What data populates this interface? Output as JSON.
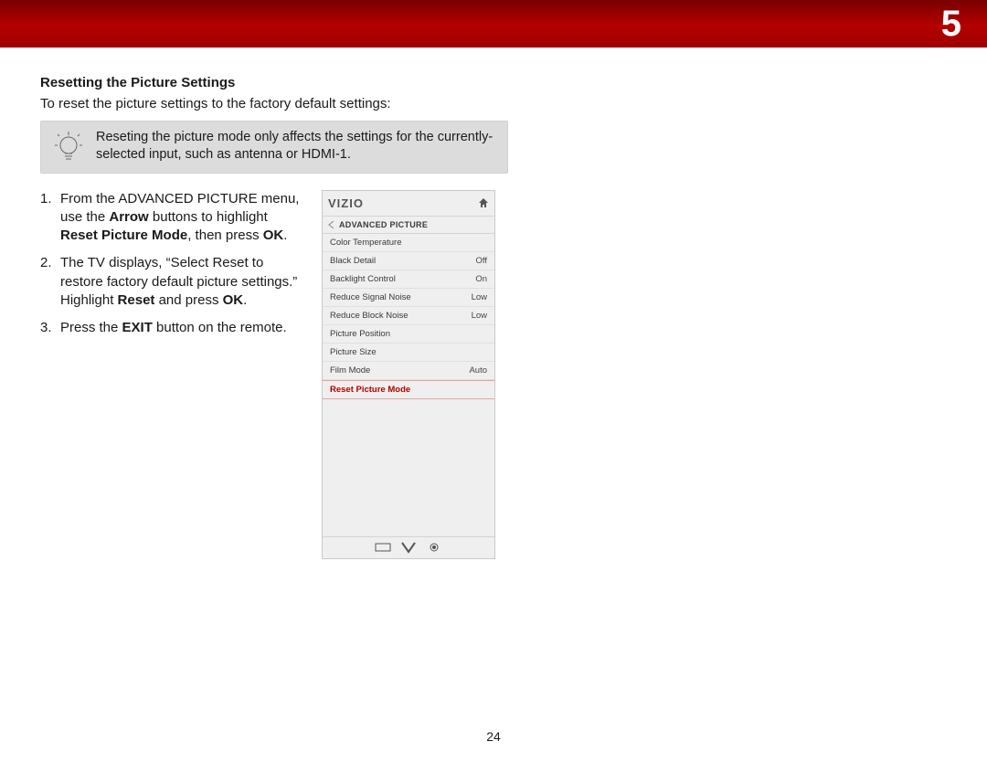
{
  "banner": {
    "chapter": "5"
  },
  "section": {
    "heading": "Resetting the Picture Settings",
    "intro": "To reset the picture settings to the factory default settings:"
  },
  "tip": {
    "text": "Reseting the picture mode only affects the settings for the currently-selected input, such as antenna or HDMI-1."
  },
  "steps": {
    "s1_num": "1.",
    "s1_a": "From the ADVANCED PICTURE menu, use the ",
    "s1_b": "Arrow",
    "s1_c": " buttons to highlight ",
    "s1_d": "Reset Picture Mode",
    "s1_e": ", then press ",
    "s1_f": "OK",
    "s1_g": ".",
    "s2_num": "2.",
    "s2_a": "The TV displays, “Select Reset to restore factory default picture settings.” Highlight ",
    "s2_b": "Reset",
    "s2_c": " and press ",
    "s2_d": "OK",
    "s2_e": ".",
    "s3_num": "3.",
    "s3_a": "Press the ",
    "s3_b": "EXIT",
    "s3_c": " button on the remote."
  },
  "osd": {
    "brand": "VIZIO",
    "title": "ADVANCED PICTURE",
    "rows": {
      "r0_label": "Color Temperature",
      "r0_val": "",
      "r1_label": "Black Detail",
      "r1_val": "Off",
      "r2_label": "Backlight Control",
      "r2_val": "On",
      "r3_label": "Reduce Signal Noise",
      "r3_val": "Low",
      "r4_label": "Reduce Block Noise",
      "r4_val": "Low",
      "r5_label": "Picture Position",
      "r5_val": "",
      "r6_label": "Picture Size",
      "r6_val": "",
      "r7_label": "Film Mode",
      "r7_val": "Auto",
      "r8_label": "Reset Picture Mode",
      "r8_val": ""
    }
  },
  "page_number": "24"
}
